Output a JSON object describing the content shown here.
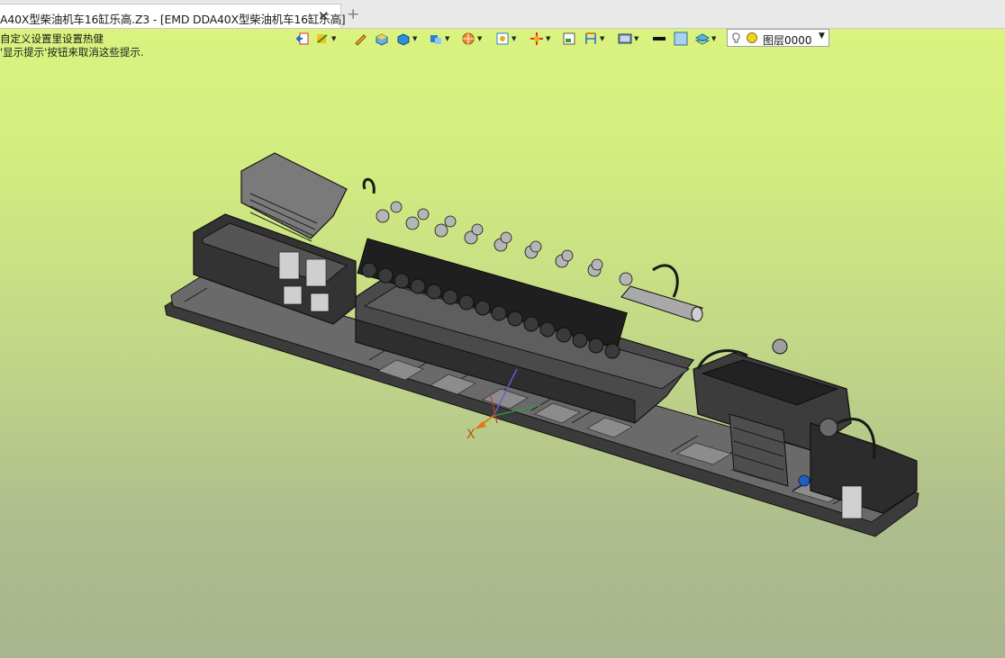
{
  "tabs": {
    "active_label": "A40X型柴油机车16缸乐高.Z3 - [EMD DDA40X型柴油机车16缸乐高]",
    "close_glyph": "✕",
    "add_glyph": "+"
  },
  "hints": {
    "line1": "自定义设置里设置热健",
    "line2": "'显示提示'按钮来取消这些提示."
  },
  "toolbar": {
    "items": [
      "exit-sketch-icon",
      "shading-icon",
      "pencil-icon",
      "box-icon",
      "solid-icon",
      "view-icon",
      "render-icon",
      "filter-icon",
      "snap-icon",
      "window-icon",
      "dimension-icon",
      "display-icon",
      "line-color-icon",
      "fill-color-icon",
      "layer-icon"
    ]
  },
  "layer": {
    "label": "图层0000"
  },
  "axis": {
    "x_label": "X"
  },
  "colors": {
    "bg_top": "#dcf57f",
    "bg_bottom": "#a8b58e",
    "model_dark": "#2a2a2a",
    "model_mid": "#5a5a5a",
    "model_light": "#9a9a9a",
    "axis_x": "#e07a10"
  }
}
